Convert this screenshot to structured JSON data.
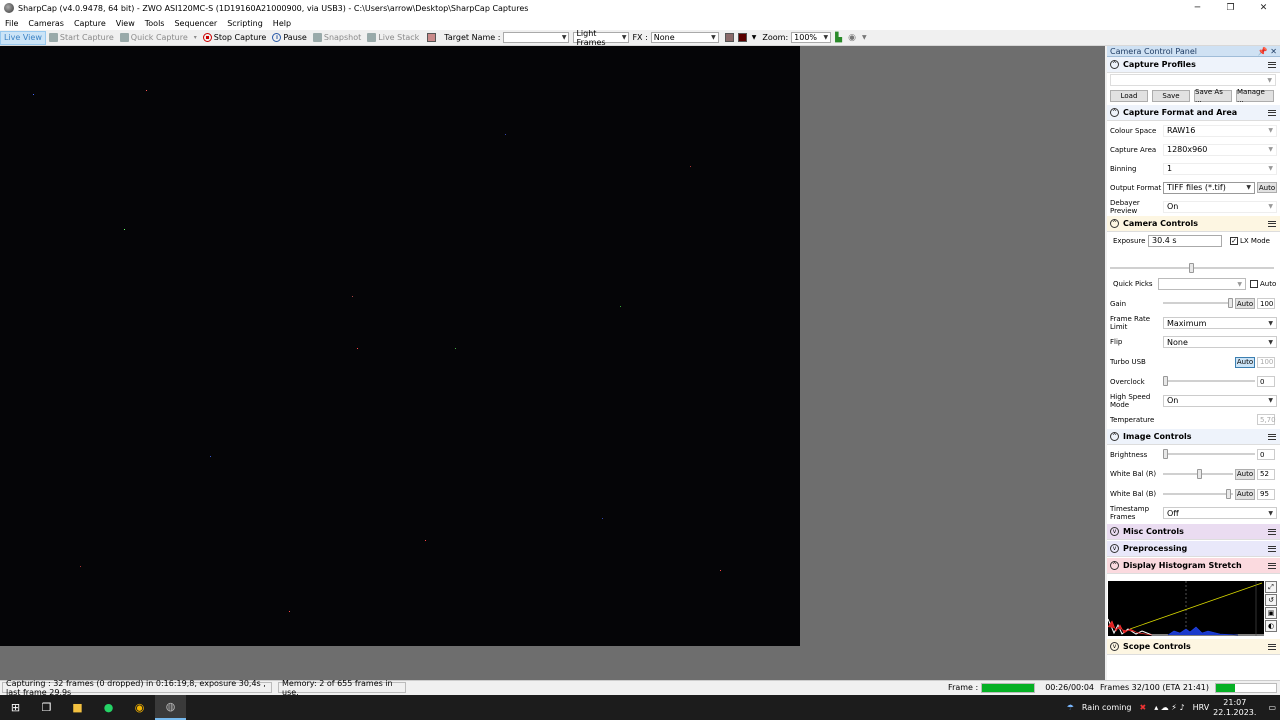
{
  "window": {
    "title": "SharpCap (v4.0.9478, 64 bit) - ZWO ASI120MC-S (1D19160A21000900, via USB3) - C:\\Users\\arrow\\Desktop\\SharpCap Captures",
    "minimize": "─",
    "maximize": "❐",
    "close": "✕"
  },
  "menu": [
    "File",
    "Cameras",
    "Capture",
    "View",
    "Tools",
    "Sequencer",
    "Scripting",
    "Help"
  ],
  "toolbar": {
    "live_view": "Live View",
    "start_capture": "Start Capture",
    "quick_capture": "Quick Capture",
    "stop_capture": "Stop Capture",
    "pause": "Pause",
    "snapshot": "Snapshot",
    "live_stack": "Live Stack",
    "target_name_label": "Target Name :",
    "target_name_value": "",
    "frame_type": "Light Frames",
    "fx_label": "FX :",
    "fx_value": "None",
    "zoom_label": "Zoom:",
    "zoom_value": "100%"
  },
  "panel": {
    "title": "Camera Control Panel",
    "pin": "📌 ✕",
    "capture_profiles": {
      "title": "Capture Profiles",
      "selected": "",
      "load": "Load",
      "save": "Save",
      "save_as": "Save As ...",
      "manage": "Manage ..."
    },
    "format": {
      "title": "Capture Format and Area",
      "colour_space_label": "Colour Space",
      "colour_space": "RAW16",
      "capture_area_label": "Capture Area",
      "capture_area": "1280x960",
      "binning_label": "Binning",
      "binning": "1",
      "output_format_label": "Output Format",
      "output_format": "TIFF files (*.tif)",
      "output_auto": "Auto",
      "debayer_label": "Debayer Preview",
      "debayer": "On"
    },
    "camera": {
      "title": "Camera Controls",
      "exposure_label": "Exposure",
      "exposure": "30.4 s",
      "lx_mode": "LX Mode",
      "lx_checked": "✓",
      "quick_picks_label": "Quick Picks",
      "quick_picks": "",
      "quick_auto": "Auto",
      "gain_label": "Gain",
      "gain_auto": "Auto",
      "gain": "100",
      "frame_rate_label": "Frame Rate Limit",
      "frame_rate": "Maximum",
      "flip_label": "Flip",
      "flip": "None",
      "turbo_label": "Turbo USB",
      "turbo_auto": "Auto",
      "turbo": "100",
      "overclock_label": "Overclock",
      "overclock": "0",
      "high_speed_label": "High Speed Mode",
      "high_speed": "On",
      "temperature_label": "Temperature",
      "temperature": "5,70"
    },
    "image": {
      "title": "Image Controls",
      "brightness_label": "Brightness",
      "brightness": "0",
      "wb_r_label": "White Bal (R)",
      "wb_r_auto": "Auto",
      "wb_r": "52",
      "wb_b_label": "White Bal (B)",
      "wb_b_auto": "Auto",
      "wb_b": "95",
      "timestamp_label": "Timestamp Frames",
      "timestamp": "Off"
    },
    "misc": {
      "title": "Misc Controls"
    },
    "pre": {
      "title": "Preprocessing"
    },
    "histo": {
      "title": "Display Histogram Stretch"
    },
    "scope": {
      "title": "Scope Controls"
    }
  },
  "status": {
    "capturing": "Capturing : 32 frames (0 dropped) in 0:16:19,8, exposure 30,4s , last frame 29,9s",
    "memory": "Memory: 2 of 655 frames in use.",
    "frame_label": "Frame :",
    "frame_progress": 1.0,
    "elapsed": "00:26/00:04",
    "frames": "Frames 32/100 (ETA 21:41)",
    "overall_progress": 0.32
  },
  "taskbar": {
    "weather": "Rain coming",
    "lang": "HRV",
    "time": "21:07",
    "date": "22.1.2023."
  },
  "colors": {
    "accent": "#3b82c4",
    "progress": "#06b025"
  }
}
